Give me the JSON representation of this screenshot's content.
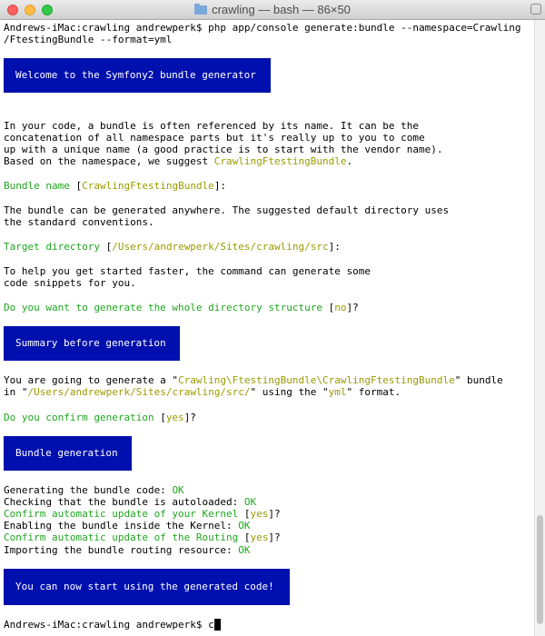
{
  "window": {
    "title": "crawling — bash — 86×50",
    "folder_icon": "folder-icon"
  },
  "terminal": {
    "l01": "Andrews-iMac:crawling andrewperk$ php app/console generate:bundle --namespace=Crawling",
    "l02": "/FtestingBundle --format=yml",
    "banner_welcome": "Welcome to the Symfony2 bundle generator",
    "p1_l1": "In your code, a bundle is often referenced by its name. It can be the",
    "p1_l2": "concatenation of all namespace parts but it's really up to you to come",
    "p1_l3": "up with a unique name (a good practice is to start with the vendor name).",
    "p1_l4_a": "Based on the namespace, we suggest ",
    "p1_l4_b": "CrawlingFtestingBundle",
    "p1_l4_c": ".",
    "bundle_name_label": "Bundle name ",
    "bundle_name_default_open": "[",
    "bundle_name_default": "CrawlingFtestingBundle",
    "bundle_name_default_close": "]:",
    "p2_l1": "The bundle can be generated anywhere. The suggested default directory uses",
    "p2_l2": "the standard conventions.",
    "target_dir_label": "Target directory ",
    "target_dir_open": "[",
    "target_dir_default": "/Users/andrewperk/Sites/crawling/src",
    "target_dir_close": "]:",
    "p3_l1": "To help you get started faster, the command can generate some",
    "p3_l2": "code snippets for you.",
    "q_structure_label": "Do you want to generate the whole directory structure ",
    "q_structure_open": "[",
    "q_structure_default": "no",
    "q_structure_close": "]?",
    "banner_summary": "Summary before generation",
    "sum_l1_a": "You are going to generate a \"",
    "sum_l1_b": "Crawling\\FtestingBundle\\CrawlingFtestingBundle",
    "sum_l1_c": "\" bundle",
    "sum_l2_a": "in \"",
    "sum_l2_b": "/Users/andrewperk/Sites/crawling/src/",
    "sum_l2_c": "\" using the \"",
    "sum_l2_d": "yml",
    "sum_l2_e": "\" format.",
    "q_confirm_label": "Do you confirm generation ",
    "q_confirm_open": "[",
    "q_confirm_default": "yes",
    "q_confirm_close": "]?",
    "banner_generation": "Bundle generation",
    "gen1_a": "Generating the bundle code: ",
    "gen1_b": "OK",
    "gen2_a": "Checking that the bundle is autoloaded: ",
    "gen2_b": "OK",
    "gen3_a": "Confirm automatic update of your Kernel ",
    "gen3_b": "[",
    "gen3_c": "yes",
    "gen3_d": "]?",
    "gen4_a": "Enabling the bundle inside the Kernel: ",
    "gen4_b": "OK",
    "gen5_a": "Confirm automatic update of the Routing ",
    "gen5_b": "[",
    "gen5_c": "yes",
    "gen5_d": "]?",
    "gen6_a": "Importing the bundle routing resource: ",
    "gen6_b": "OK",
    "banner_done": "You can now start using the generated code!",
    "prompt_final": "Andrews-iMac:crawling andrewperk$ ",
    "prompt_input": "c"
  },
  "colors": {
    "banner_bg": "#0010ae",
    "question_green": "#1fa61f",
    "default_yellow": "#9a9a00"
  }
}
